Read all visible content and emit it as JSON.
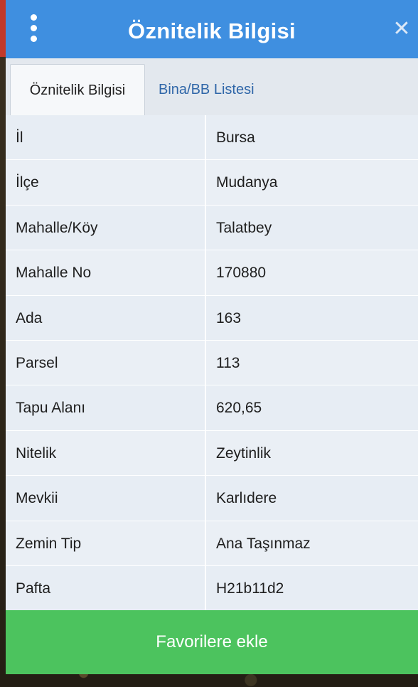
{
  "header": {
    "title": "Öznitelik Bilgisi",
    "close_glyph": "✕"
  },
  "tabs": [
    {
      "label": "Öznitelik Bilgisi",
      "active": true
    },
    {
      "label": "Bina/BB Listesi",
      "active": false
    }
  ],
  "rows": [
    {
      "label": "İl",
      "value": "Bursa"
    },
    {
      "label": "İlçe",
      "value": "Mudanya"
    },
    {
      "label": "Mahalle/Köy",
      "value": "Talatbey"
    },
    {
      "label": "Mahalle No",
      "value": "170880"
    },
    {
      "label": "Ada",
      "value": "163"
    },
    {
      "label": "Parsel",
      "value": "113"
    },
    {
      "label": "Tapu Alanı",
      "value": "620,65"
    },
    {
      "label": "Nitelik",
      "value": "Zeytinlik"
    },
    {
      "label": "Mevkii",
      "value": "Karlıdere"
    },
    {
      "label": "Zemin Tip",
      "value": "Ana Taşınmaz"
    },
    {
      "label": "Pafta",
      "value": "H21b11d2"
    }
  ],
  "actions": {
    "favorite_label": "Favorilere ekle"
  },
  "colors": {
    "header": "#3f8fe0",
    "button": "#4cc35e",
    "tab_link": "#2f66a8"
  },
  "icons": {
    "menu": "more-vertical-icon",
    "close": "close-icon"
  }
}
